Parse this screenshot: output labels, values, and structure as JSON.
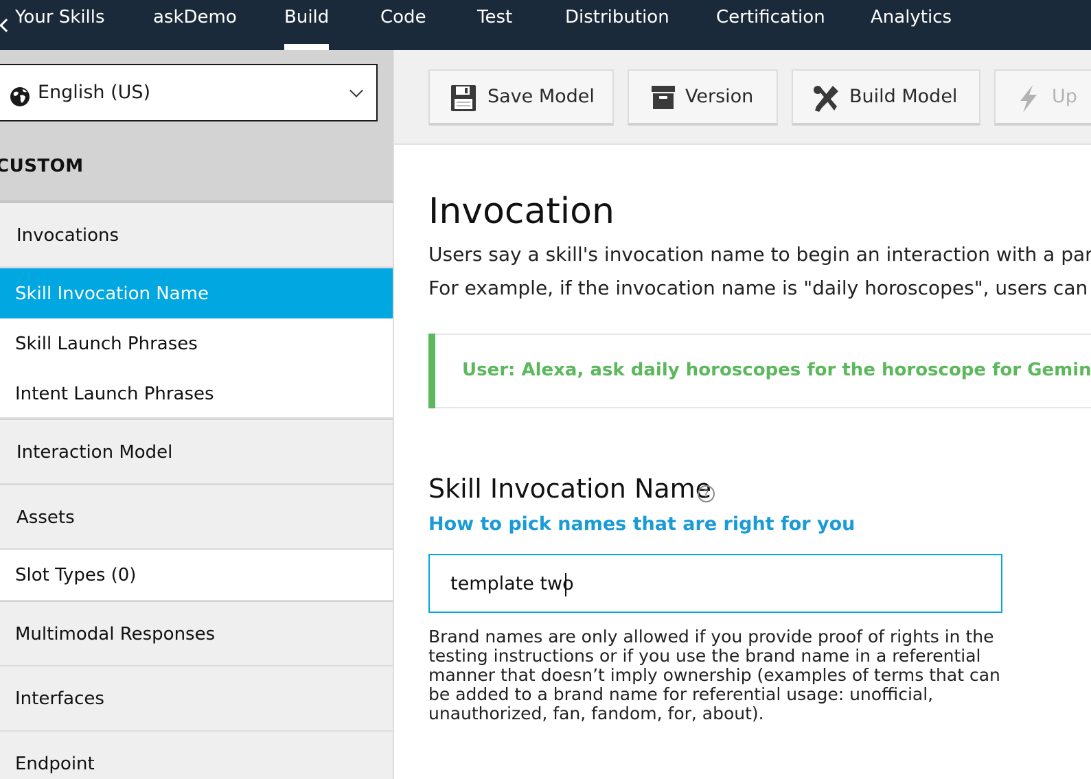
{
  "topnav": {
    "back_label": "Your Skills",
    "items": [
      {
        "label": "askDemo"
      },
      {
        "label": "Build"
      },
      {
        "label": "Code"
      },
      {
        "label": "Test"
      },
      {
        "label": "Distribution"
      },
      {
        "label": "Certification"
      },
      {
        "label": "Analytics"
      }
    ],
    "active_tab": "Build"
  },
  "sidebar": {
    "locale": "English (US)",
    "section": "CUSTOM",
    "items": [
      {
        "label": "Invocations"
      },
      {
        "label": "Skill Invocation Name"
      },
      {
        "label": "Skill Launch Phrases"
      },
      {
        "label": "Intent Launch Phrases"
      },
      {
        "label": "Interaction Model"
      },
      {
        "label": "Assets"
      },
      {
        "label": "Slot Types (0)"
      },
      {
        "label": "Multimodal Responses"
      },
      {
        "label": "Interfaces"
      },
      {
        "label": "Endpoint"
      }
    ],
    "selected": "Skill Invocation Name"
  },
  "toolbar": {
    "save_label": "Save Model",
    "version_label": "Version",
    "build_label": "Build Model",
    "update_label": "Up"
  },
  "main": {
    "title": "Invocation",
    "intro_line1": "Users say a skill's invocation name to begin an interaction with a part",
    "intro_line2": "For example, if the invocation name is \"daily horoscopes\", users can sa",
    "example": "User: Alexa, ask daily horoscopes for the horoscope for Gemini",
    "field_title": "Skill Invocation Name",
    "help_glyph": "?",
    "help_link": "How to pick names that are right for you",
    "input_value": "template two",
    "brand_note": "Brand names are only allowed if you provide proof of rights in the testing instructions or if you use the brand name in a referential manner that doesn’t imply ownership (examples of terms that can be added to a brand name for referential usage: unofficial, unauthorized, fan, fandom, for, about)."
  },
  "colors": {
    "nav_bg": "#1b2a3b",
    "accent": "#00a7e1",
    "example_green": "#5cb85c",
    "link_blue": "#1a9bd7"
  }
}
